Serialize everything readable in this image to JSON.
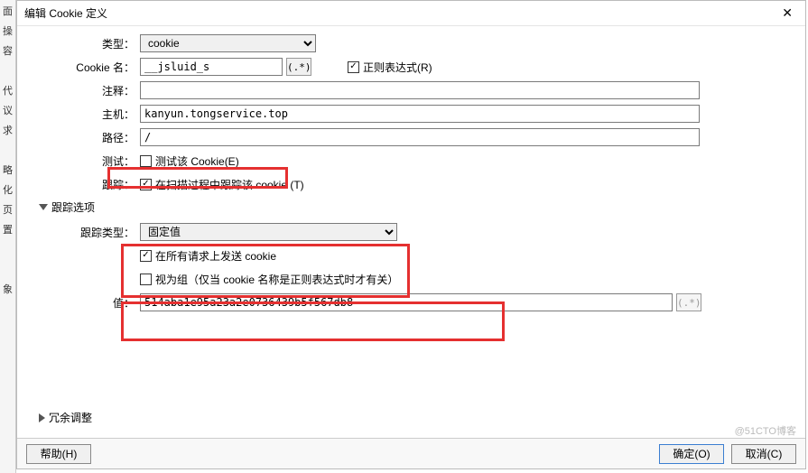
{
  "left_strip": [
    "面",
    "操",
    "容",
    "",
    "代",
    "议",
    "求",
    "",
    "略",
    "化",
    "页",
    "置",
    "",
    "",
    "象"
  ],
  "title": "编辑 Cookie 定义",
  "labels": {
    "type": "类型：",
    "name": "Cookie 名：",
    "comment": "注释：",
    "host": "主机：",
    "path": "路径：",
    "test": "测试：",
    "track": "跟踪：",
    "track_type": "跟踪类型：",
    "value": "值："
  },
  "fields": {
    "type_option": "cookie",
    "name": "__jsluid_s",
    "regex_btn": "(.*)",
    "regex_chk_label": "正则表达式(R)",
    "comment": "",
    "host": "kanyun.tongservice.top",
    "path": "/",
    "test_chk_label": "测试该 Cookie(E)",
    "track_chk_label": "在扫描过程中跟踪该 cookie (T)",
    "track_type_option": "固定值",
    "send_all_label": "在所有请求上发送 cookie",
    "group_label": "视为组（仅当 cookie 名称是正则表达式时才有关）",
    "value": "514aba1e95a23a2e0736439b5f567db8"
  },
  "sections": {
    "track_options": "跟踪选项",
    "redundancy": "冗余调整"
  },
  "buttons": {
    "help": "帮助(H)",
    "ok": "确定(O)",
    "cancel": "取消(C)"
  },
  "watermark": "@51CTO博客"
}
